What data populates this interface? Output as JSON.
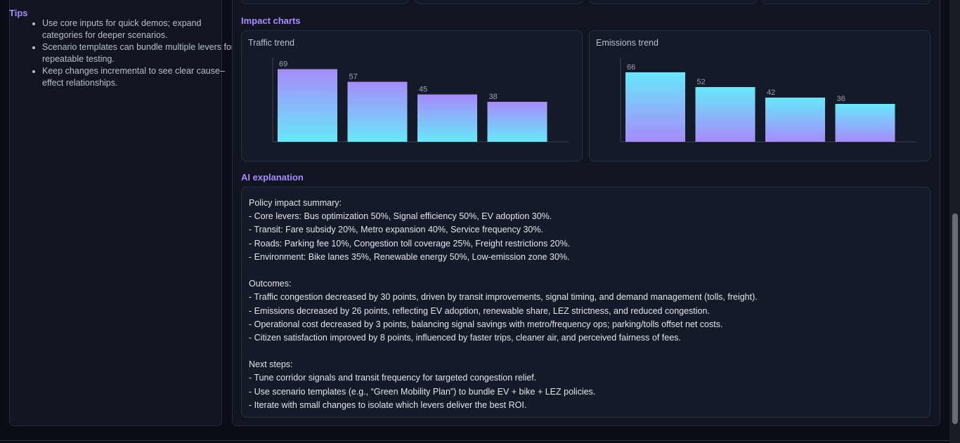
{
  "tips": {
    "title": "Tips",
    "items": [
      "Use core inputs for quick demos; expand categories for deeper scenarios.",
      "Scenario templates can bundle multiple levers for repeatable testing.",
      "Keep changes incremental to see clear cause–effect relationships."
    ]
  },
  "impact_charts": {
    "title": "Impact charts"
  },
  "chart_data": [
    {
      "type": "bar",
      "title": "Traffic trend",
      "categories": [
        "",
        "",
        "",
        ""
      ],
      "values": [
        69,
        57,
        45,
        38
      ],
      "gradient": [
        "#a78bfa",
        "#67e8f9"
      ],
      "ylim": [
        0,
        80
      ],
      "grid": false
    },
    {
      "type": "bar",
      "title": "Emissions trend",
      "categories": [
        "",
        "",
        "",
        ""
      ],
      "values": [
        66,
        52,
        42,
        36
      ],
      "gradient": [
        "#67e8f9",
        "#a78bfa"
      ],
      "ylim": [
        0,
        80
      ],
      "grid": false
    }
  ],
  "ai_explanation": {
    "title": "AI explanation",
    "lines": [
      "Policy impact summary:",
      "- Core levers: Bus optimization 50%, Signal efficiency 50%, EV adoption 30%.",
      "- Transit: Fare subsidy 20%, Metro expansion 40%, Service frequency 30%.",
      "- Roads: Parking fee 10%, Congestion toll coverage 25%, Freight restrictions 20%.",
      "- Environment: Bike lanes 35%, Renewable energy 50%, Low-emission zone 30%.",
      "",
      "Outcomes:",
      "- Traffic congestion decreased by 30 points, driven by transit improvements, signal timing, and demand management (tolls, freight).",
      "- Emissions decreased by 26 points, reflecting EV adoption, renewable share, LEZ strictness, and reduced congestion.",
      "- Operational cost decreased by 3 points, balancing signal savings with metro/frequency ops; parking/tolls offset net costs.",
      "- Citizen satisfaction improved by 8 points, influenced by faster trips, cleaner air, and perceived fairness of fees.",
      "",
      "Next steps:",
      "- Tune corridor signals and transit frequency for targeted congestion relief.",
      "- Use scenario templates (e.g., “Green Mobility Plan”) to bundle EV + bike + LEZ policies.",
      "- Iterate with small changes to isolate which levers deliver the best ROI."
    ]
  },
  "colors": {
    "accent": "#a98bff",
    "panel": "#111522",
    "card": "#151a28",
    "border": "#2a3142"
  }
}
